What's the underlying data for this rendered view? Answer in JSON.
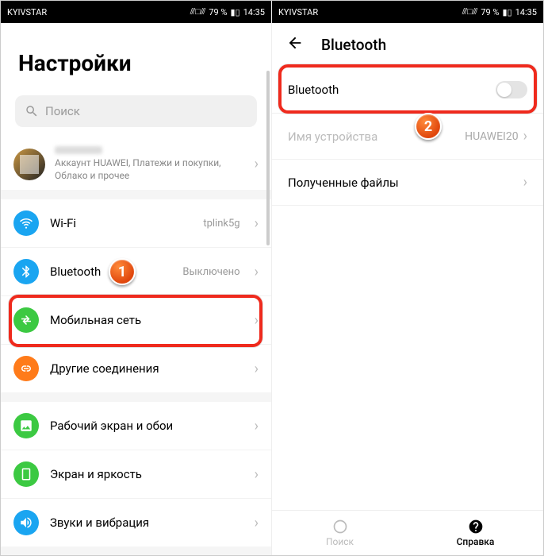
{
  "status": {
    "carrier": "KYIVSTAR",
    "battery": "79 %",
    "time": "14:35"
  },
  "left": {
    "title": "Настройки",
    "search_placeholder": "Поиск",
    "account_sub": "Аккаунт HUAWEI, Платежи и покупки, Облако и прочее",
    "items": {
      "wifi": {
        "label": "Wi-Fi",
        "value": "tplink5g"
      },
      "bluetooth": {
        "label": "Bluetooth",
        "value": "Выключено"
      },
      "mobile": {
        "label": "Мобильная сеть"
      },
      "connections": {
        "label": "Другие соединения"
      },
      "wallpaper": {
        "label": "Рабочий экран и обои"
      },
      "display": {
        "label": "Экран и яркость"
      },
      "sound": {
        "label": "Звуки и вибрация"
      }
    }
  },
  "right": {
    "title": "Bluetooth",
    "toggle_label": "Bluetooth",
    "device_name_label": "Имя устройства",
    "device_name_value": "HUAWEI20",
    "received_label": "Полученные файлы",
    "tab_search": "Поиск",
    "tab_help": "Справка"
  },
  "markers": {
    "one": "1",
    "two": "2"
  }
}
